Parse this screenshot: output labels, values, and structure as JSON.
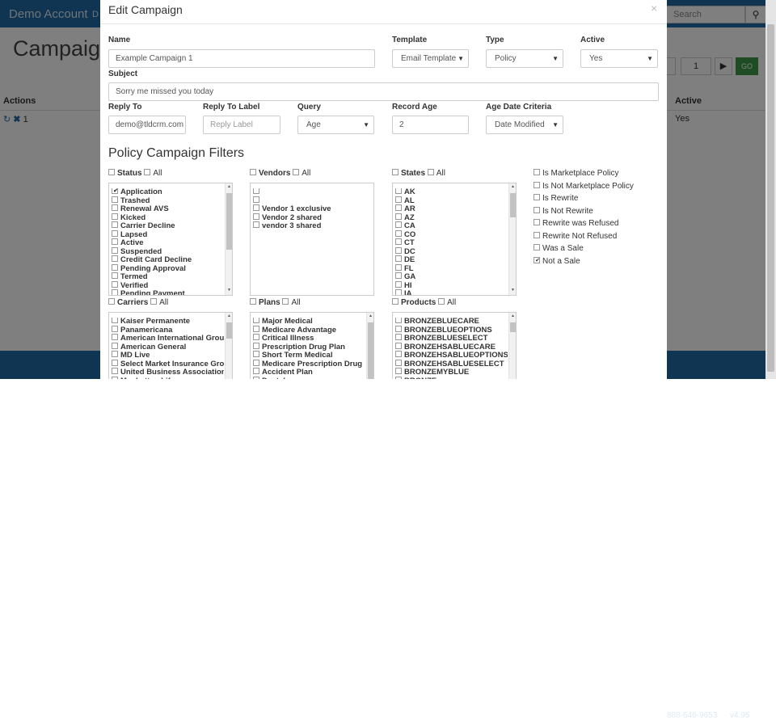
{
  "background": {
    "brand": "Demo Account",
    "brand_fragment": "D",
    "search_placeholder": "Search",
    "page_title": "Campaign",
    "pagination": {
      "page": "1",
      "next": "▶",
      "go": "GO"
    },
    "table_headers": {
      "actions": "Actions",
      "active": "Active"
    },
    "row": {
      "id": "1",
      "active": "Yes"
    },
    "footer": {
      "phone": "888-646-9653",
      "version": "v4.95"
    }
  },
  "modal": {
    "title": "Edit Campaign",
    "close": "×",
    "fields": {
      "name": {
        "label": "Name",
        "value": "Example Campaign 1"
      },
      "template": {
        "label": "Template",
        "value": "Email Template"
      },
      "type": {
        "label": "Type",
        "value": "Policy"
      },
      "active": {
        "label": "Active",
        "value": "Yes"
      },
      "subject": {
        "label": "Subject",
        "value": "Sorry me missed you today"
      },
      "reply_to": {
        "label": "Reply To",
        "value": "demo@tldcrm.com"
      },
      "reply_to_label": {
        "label": "Reply To Label",
        "placeholder": "Reply Label"
      },
      "query": {
        "label": "Query",
        "value": "Age"
      },
      "record_age": {
        "label": "Record Age",
        "value": "2"
      },
      "age_date_criteria": {
        "label": "Age Date Criteria",
        "value": "Date Modified"
      }
    },
    "filters_title": "Policy Campaign Filters",
    "all_label": "All",
    "status": {
      "label": "Status",
      "items": [
        {
          "label": "Application",
          "checked": true
        },
        {
          "label": "Trashed",
          "checked": false
        },
        {
          "label": "Renewal AVS",
          "checked": false
        },
        {
          "label": "Kicked",
          "checked": false
        },
        {
          "label": "Carrier Decline",
          "checked": false
        },
        {
          "label": "Lapsed",
          "checked": false
        },
        {
          "label": "Active",
          "checked": false
        },
        {
          "label": "Suspended",
          "checked": false
        },
        {
          "label": "Credit Card Decline",
          "checked": false
        },
        {
          "label": "Pending Approval",
          "checked": false
        },
        {
          "label": "Termed",
          "checked": false
        },
        {
          "label": "Verified",
          "checked": false
        },
        {
          "label": "Pending Payment",
          "checked": false
        }
      ]
    },
    "vendors": {
      "label": "Vendors",
      "items": [
        {
          "label": "",
          "checked": false
        },
        {
          "label": "",
          "checked": false
        },
        {
          "label": "Vendor 1 exclusive",
          "checked": false
        },
        {
          "label": "Vendor 2 shared",
          "checked": false
        },
        {
          "label": "vendor 3 shared",
          "checked": false
        }
      ]
    },
    "states": {
      "label": "States",
      "items": [
        {
          "label": "AK",
          "checked": false
        },
        {
          "label": "AL",
          "checked": false
        },
        {
          "label": "AR",
          "checked": false
        },
        {
          "label": "AZ",
          "checked": false
        },
        {
          "label": "CA",
          "checked": false
        },
        {
          "label": "CO",
          "checked": false
        },
        {
          "label": "CT",
          "checked": false
        },
        {
          "label": "DC",
          "checked": false
        },
        {
          "label": "DE",
          "checked": false
        },
        {
          "label": "FL",
          "checked": false
        },
        {
          "label": "GA",
          "checked": false
        },
        {
          "label": "HI",
          "checked": false
        },
        {
          "label": "IA",
          "checked": false
        }
      ]
    },
    "policy_flags": [
      {
        "label": "Is Marketplace Policy",
        "checked": false
      },
      {
        "label": "Is Not Marketplace Policy",
        "checked": false
      },
      {
        "label": "Is Rewrite",
        "checked": false
      },
      {
        "label": "Is Not Rewrite",
        "checked": false
      },
      {
        "label": "Rewrite was Refused",
        "checked": false
      },
      {
        "label": "Rewrite Not Refused",
        "checked": false
      },
      {
        "label": "Was a Sale",
        "checked": false
      },
      {
        "label": "Not a Sale",
        "checked": true
      }
    ],
    "carriers": {
      "label": "Carriers",
      "items": [
        {
          "label": "Kaiser Permanente",
          "checked": false
        },
        {
          "label": "Panamericana",
          "checked": false
        },
        {
          "label": "American International Group",
          "checked": false
        },
        {
          "label": "American General",
          "checked": false
        },
        {
          "label": "MD Live",
          "checked": false
        },
        {
          "label": "Select Market Insurance Group",
          "checked": false
        },
        {
          "label": "United Business Association",
          "checked": false
        },
        {
          "label": "Manhattan Life",
          "checked": false
        }
      ]
    },
    "plans": {
      "label": "Plans",
      "items": [
        {
          "label": "Major Medical",
          "checked": false
        },
        {
          "label": "Medicare Advantage",
          "checked": false
        },
        {
          "label": "Critical Illness",
          "checked": false
        },
        {
          "label": "Prescription Drug Plan",
          "checked": false
        },
        {
          "label": "Short Term Medical",
          "checked": false
        },
        {
          "label": "Medicare Prescription Drug",
          "checked": false
        },
        {
          "label": "Accident Plan",
          "checked": false
        },
        {
          "label": "Dental",
          "checked": false
        }
      ]
    },
    "products": {
      "label": "Products",
      "items": [
        {
          "label": "BRONZEBLUECARE",
          "checked": false
        },
        {
          "label": "BRONZEBLUEOPTIONS",
          "checked": false
        },
        {
          "label": "BRONZEBLUESELECT",
          "checked": false
        },
        {
          "label": "BRONZEHSABLUECARE",
          "checked": false
        },
        {
          "label": "BRONZEHSABLUEOPTIONS",
          "checked": false
        },
        {
          "label": "BRONZEHSABLUESELECT",
          "checked": false
        },
        {
          "label": "BRONZEMYBLUE",
          "checked": false
        },
        {
          "label": "BRONZE",
          "checked": false
        }
      ]
    }
  }
}
